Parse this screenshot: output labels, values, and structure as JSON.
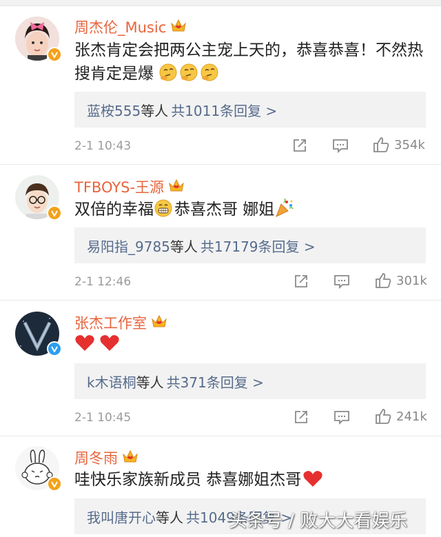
{
  "comments": [
    {
      "username": "周杰伦_Music",
      "text_before": "张杰肯定会把两公主宠上天的，恭喜恭喜！不然热搜肯定是爆",
      "replies": {
        "who": "蓝桉555",
        "mid": "等人",
        "total": "共1011条回复 >"
      },
      "time": "2-1 10:43",
      "likes": "354k",
      "verified_color": "#f3a21b"
    },
    {
      "username": "TFBOYS-王源",
      "text_before": "双倍的幸福",
      "text_after": "恭喜杰哥 娜姐",
      "replies": {
        "who": "易阳指_9785",
        "mid": "等人",
        "total": "共17179条回复 >"
      },
      "time": "2-1 12:46",
      "likes": "301k",
      "verified_color": "#f3a21b"
    },
    {
      "username": "张杰工作室",
      "text_before": "",
      "replies": {
        "who": "k木语桐",
        "mid": "等人",
        "total": "共371条回复 >"
      },
      "time": "2-1 10:45",
      "likes": "241k",
      "verified_color": "#2d9df1"
    },
    {
      "username": "周冬雨",
      "text_before": "哇快乐家族新成员 恭喜娜姐杰哥",
      "replies": {
        "who": "我叫唐开心",
        "mid": "等人",
        "total": "共1049条回复 >"
      },
      "verified_color": "#f3a21b"
    }
  ],
  "colors": {
    "username": "#e8643c",
    "link": "#566b8c",
    "heart": "#e5302f"
  },
  "icons": [
    "crown-icon",
    "verified-icon",
    "share-icon",
    "comment-icon",
    "like-icon",
    "heart-icon",
    "grin-emoji",
    "thinking-emoji",
    "party-emoji"
  ],
  "watermark": "头条号 / 败大大看娱乐"
}
